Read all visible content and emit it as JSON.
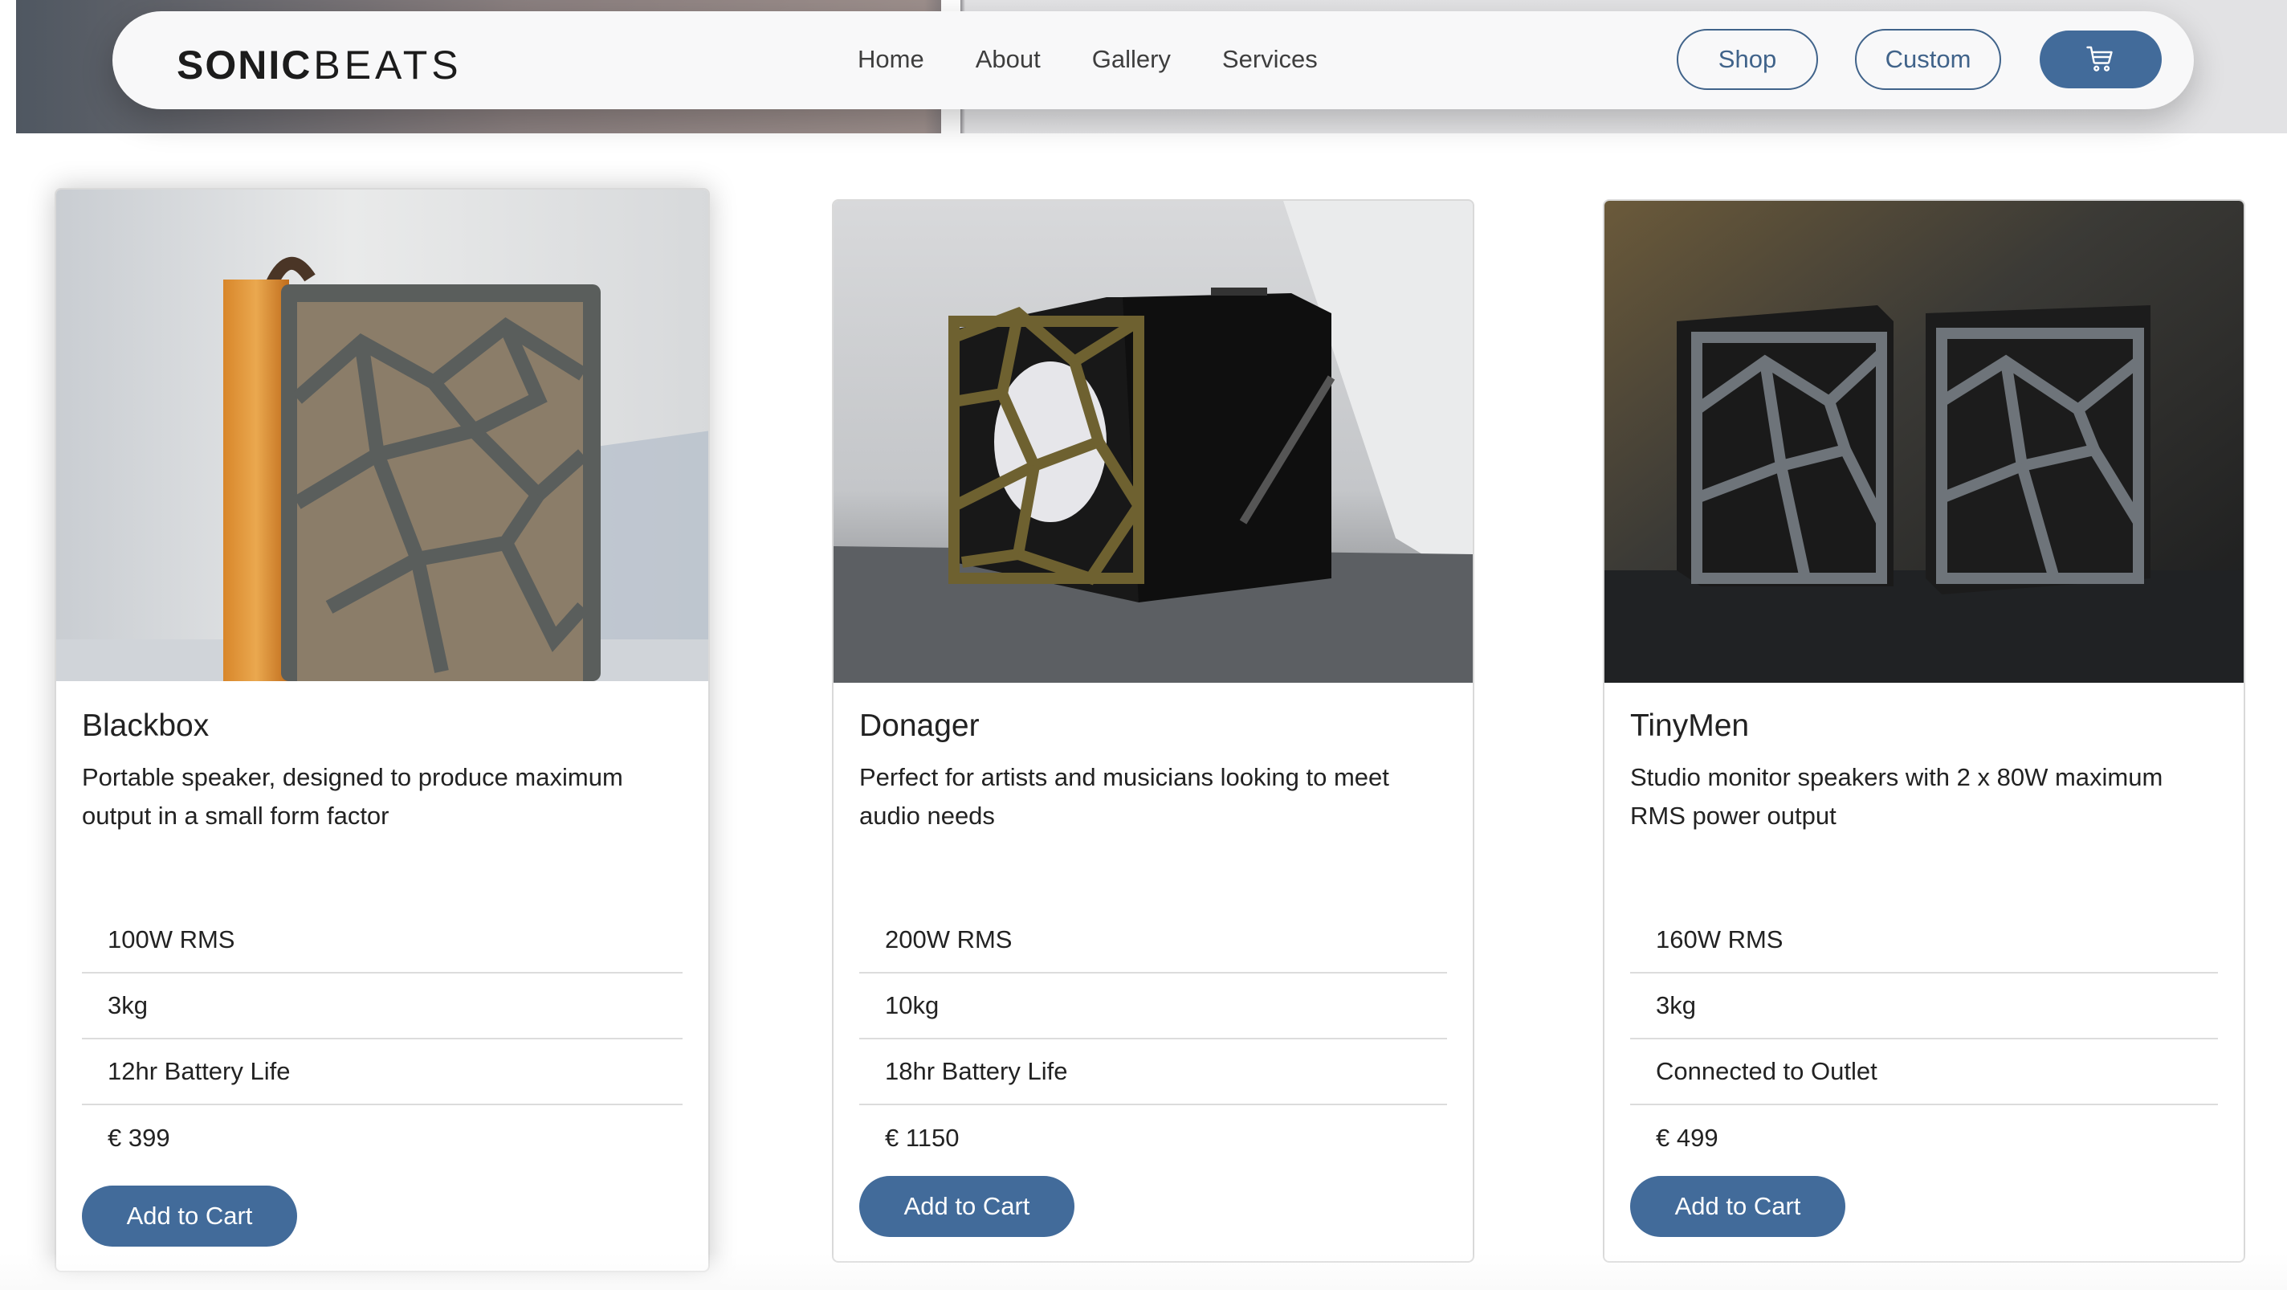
{
  "header": {
    "logo_part1": "SONIC",
    "logo_part2": "BEATS",
    "nav": [
      "Home",
      "About",
      "Gallery",
      "Services"
    ],
    "shop_label": "Shop",
    "custom_label": "Custom",
    "cart_icon": "cart-icon"
  },
  "products": [
    {
      "name": "Blackbox",
      "description": "Portable speaker, designed to produce maximum output in a small form factor",
      "specs": [
        "100W RMS",
        "3kg",
        "12hr Battery Life",
        "€ 399"
      ],
      "button": "Add to Cart"
    },
    {
      "name": "Donager",
      "description": "Perfect for artists and musicians looking to meet audio needs",
      "specs": [
        "200W RMS",
        "10kg",
        "18hr Battery Life",
        "€ 1150"
      ],
      "button": "Add to Cart"
    },
    {
      "name": "TinyMen",
      "description": "Studio monitor speakers with 2 x 80W maximum RMS power output",
      "specs": [
        "160W RMS",
        "3kg",
        "Connected to Outlet",
        "€ 499"
      ],
      "button": "Add to Cart"
    }
  ],
  "colors": {
    "primary": "#426b9a",
    "outline": "#40638a"
  }
}
